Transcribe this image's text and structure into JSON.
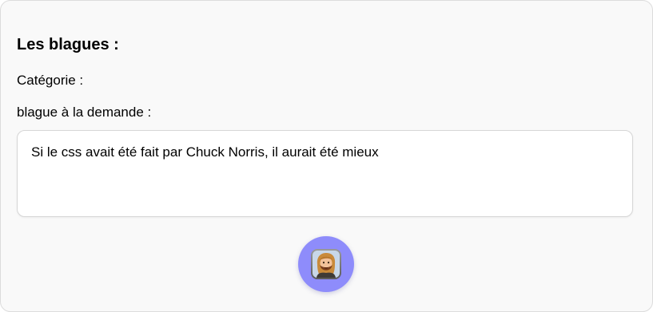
{
  "header": {
    "title": "Les blagues :"
  },
  "category": {
    "label": "Catégorie :"
  },
  "on_demand": {
    "label": "blague à la demande :"
  },
  "joke": {
    "text": "Si le css avait été fait par Chuck Norris, il aurait été mieux"
  },
  "action_button": {
    "icon": "chuck-norris-face-icon",
    "color": "#8e8cfb"
  }
}
